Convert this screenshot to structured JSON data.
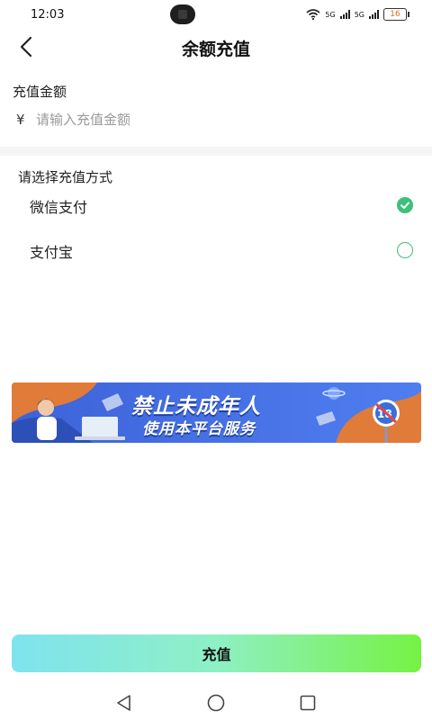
{
  "status_bar": {
    "time": "12:03",
    "network_1": "5G",
    "network_2": "5G",
    "battery": "16"
  },
  "header": {
    "title": "余额充值",
    "back_icon": "chevron-left-icon"
  },
  "amount": {
    "label": "充值金额",
    "currency_symbol": "¥",
    "placeholder": "请输入充值金额",
    "value": ""
  },
  "payment": {
    "label": "请选择充值方式",
    "methods": [
      {
        "name": "微信支付",
        "selected": true
      },
      {
        "name": "支付宝",
        "selected": false
      }
    ],
    "accent_color": "#3cc07a"
  },
  "banner": {
    "line1": "禁止未成年人",
    "line2": "使用本平台服务",
    "badge": "18"
  },
  "submit": {
    "label": "充值"
  },
  "nav": {
    "back_icon": "triangle-back-icon",
    "home_icon": "circle-home-icon",
    "recents_icon": "square-recents-icon"
  }
}
